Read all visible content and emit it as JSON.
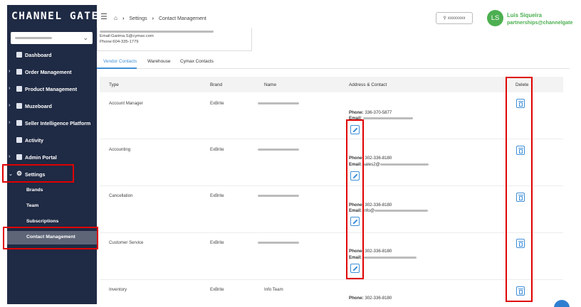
{
  "app": {
    "logo": "CHANNEL GATE"
  },
  "sidebar": {
    "items": [
      {
        "label": "Dashboard",
        "icon": "dashboard-icon",
        "expandable": false
      },
      {
        "label": "Order Management",
        "icon": "clipboard-icon",
        "expandable": true
      },
      {
        "label": "Product Management",
        "icon": "product-icon",
        "expandable": true
      },
      {
        "label": "Muzeboard",
        "icon": "board-icon",
        "expandable": true
      },
      {
        "label": "Seller Intelligence Platform",
        "icon": "chart-icon",
        "expandable": true
      },
      {
        "label": "Activity",
        "icon": "activity-icon",
        "expandable": false
      },
      {
        "label": "Admin Portal",
        "icon": "admin-icon",
        "expandable": true
      },
      {
        "label": "Settings",
        "icon": "gear-icon",
        "expandable": true
      }
    ],
    "settings_sub": [
      {
        "label": "Brands"
      },
      {
        "label": "Team"
      },
      {
        "label": "Subscriptions"
      },
      {
        "label": "Contact Management"
      }
    ]
  },
  "breadcrumb": {
    "items": [
      "Settings",
      "Contact Management"
    ]
  },
  "header": {
    "user_button": "⚲ xxxxxxxx",
    "avatar": "LS",
    "user_name": "Luis Siqueira",
    "user_email": "partnerships@channelgate"
  },
  "address_box": {
    "line_email": "Email:Garima.S@cymax.com",
    "line_phone": "Phone:604-335-1779"
  },
  "tabs": [
    "Vendor Contacts",
    "Warehouse",
    "Cymax Contacts"
  ],
  "table": {
    "headers": [
      "Type",
      "Brand",
      "Name",
      "Address & Contact",
      "Delete"
    ],
    "rows": [
      {
        "type": "Account Manager",
        "brand": "ExBrite",
        "name": "",
        "phone": "336-370-5877",
        "email_prefix": ""
      },
      {
        "type": "Accounting",
        "brand": "ExBrite",
        "name": "",
        "phone": "302-336-8180",
        "email_prefix": "sales2@"
      },
      {
        "type": "Cancellation",
        "brand": "ExBrite",
        "name": "",
        "phone": "302-336-8180",
        "email_prefix": "info@"
      },
      {
        "type": "Customer Service",
        "brand": "ExBrite",
        "name": "",
        "phone": "302-336-8180",
        "email_prefix": ""
      },
      {
        "type": "Inventory",
        "brand": "ExBrite",
        "name": "Info  Team",
        "phone": "302-336-8180",
        "email_prefix": ""
      }
    ],
    "phone_label": "Phone:",
    "email_label": "Email:"
  },
  "colors": {
    "sidebar": "#1f2a44",
    "accent": "#3f8fd8",
    "user_green": "#4caf50",
    "annotation": "#e00000"
  }
}
